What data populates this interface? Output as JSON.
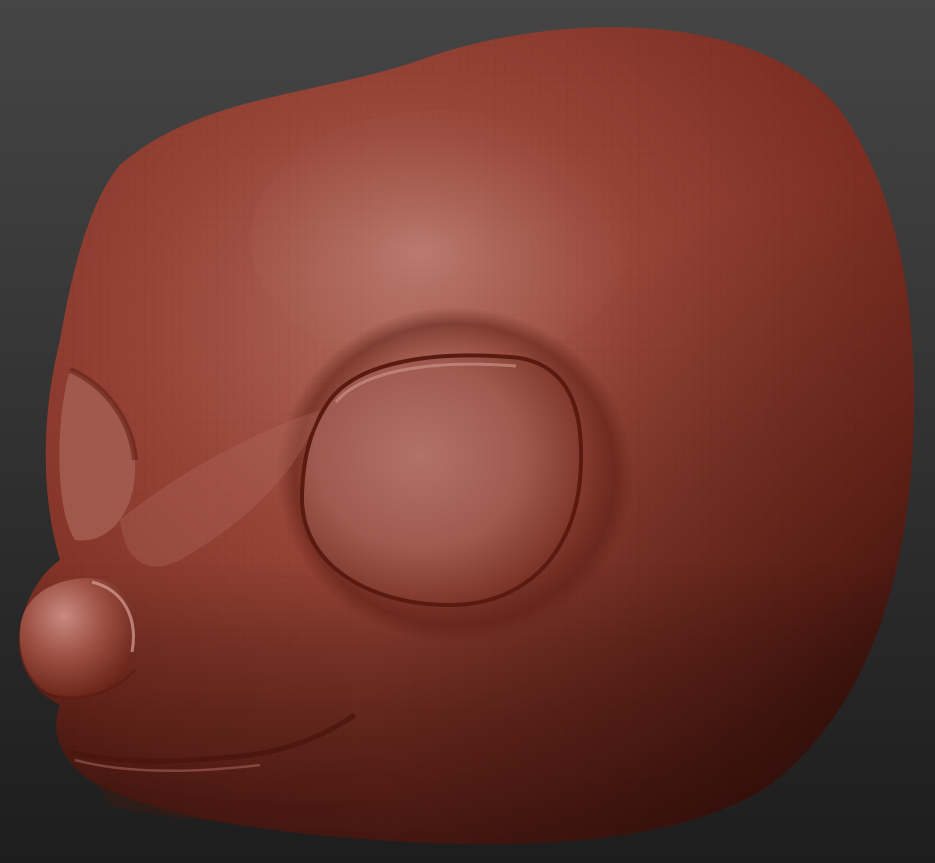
{
  "scene": {
    "subject": "sculpted-animal-head",
    "material_color": "#8a3528",
    "highlight_color": "#c98a80",
    "shadow_color": "#3a120c",
    "background_top": "#454545",
    "background_bottom": "#1d1d1d",
    "wireframe_visible": true
  }
}
